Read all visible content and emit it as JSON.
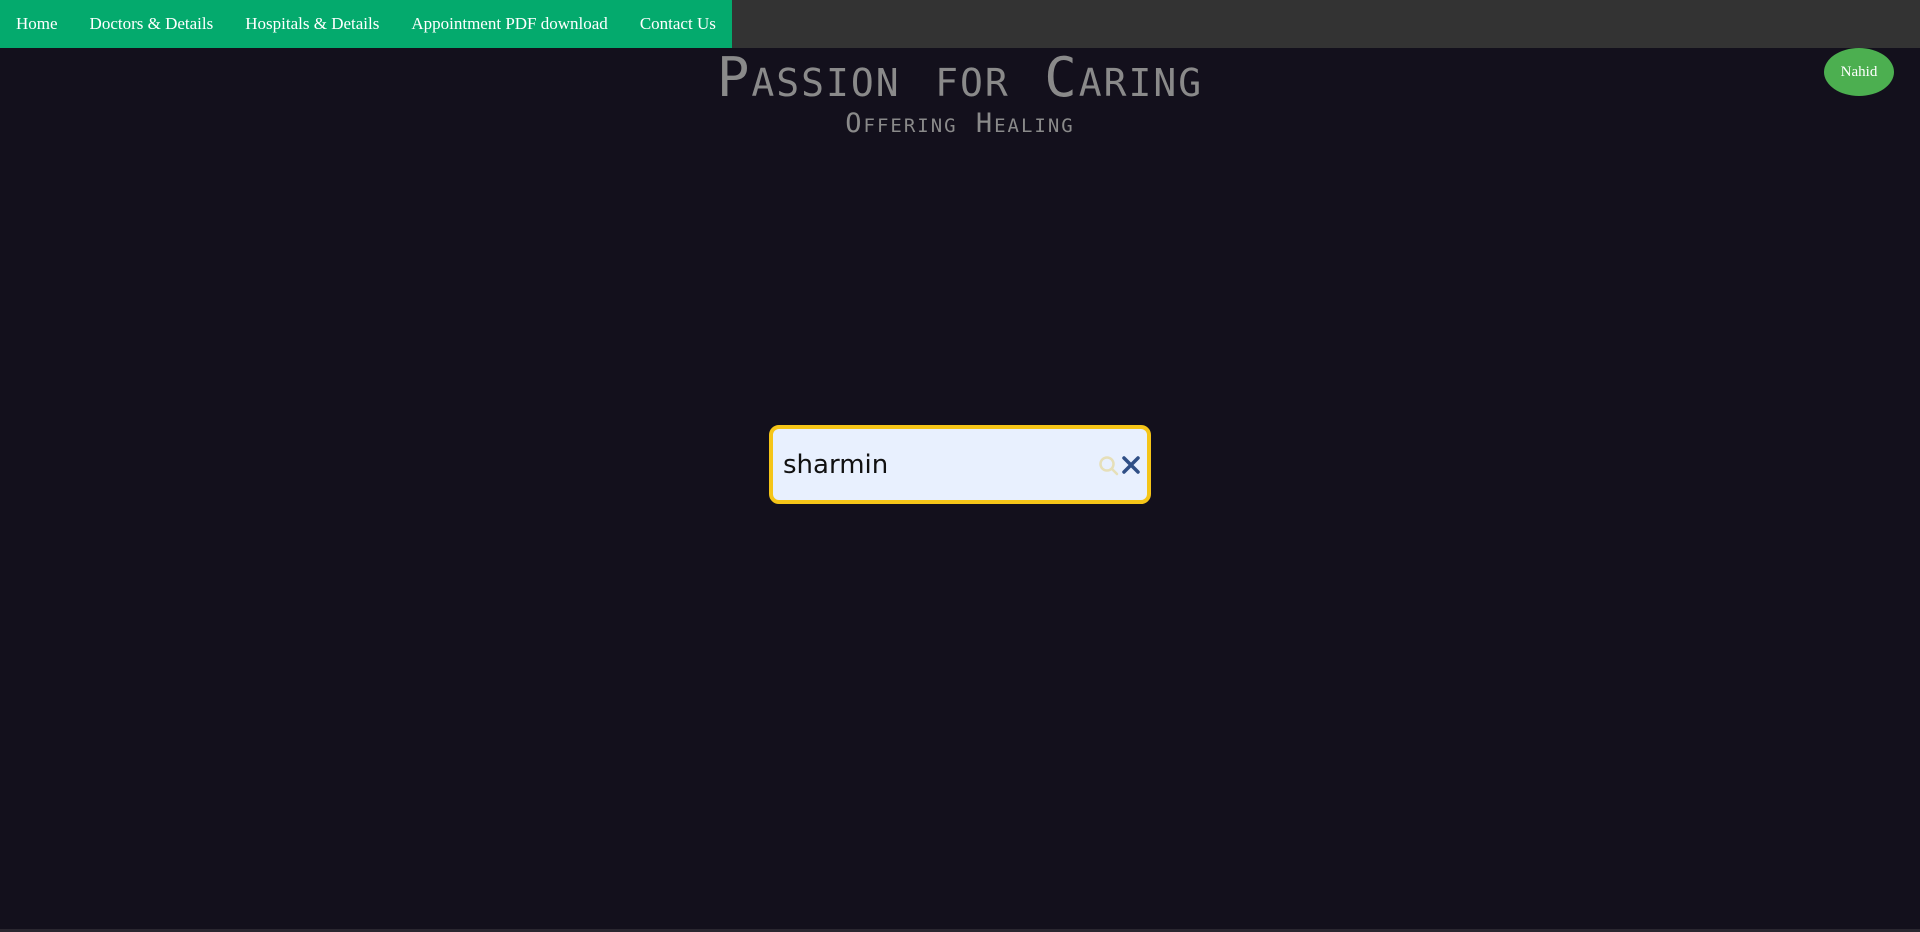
{
  "nav": {
    "items": [
      {
        "label": "Home"
      },
      {
        "label": "Doctors & Details"
      },
      {
        "label": "Hospitals & Details"
      },
      {
        "label": "Appointment PDF download"
      },
      {
        "label": "Contact Us"
      }
    ]
  },
  "hero": {
    "title": "Passion for Caring",
    "subtitle": "Offering Healing"
  },
  "user": {
    "name": "Nahid"
  },
  "search": {
    "value": "sharmin",
    "icon": "search-icon",
    "clear_icon": "close-icon"
  },
  "colors": {
    "nav_accent": "#04aa6d",
    "navbar_bg": "#333333",
    "page_bg": "#13101c",
    "avatar_bg": "#4caf50",
    "search_border": "#f5c518",
    "search_bg": "#e8f0fe"
  }
}
